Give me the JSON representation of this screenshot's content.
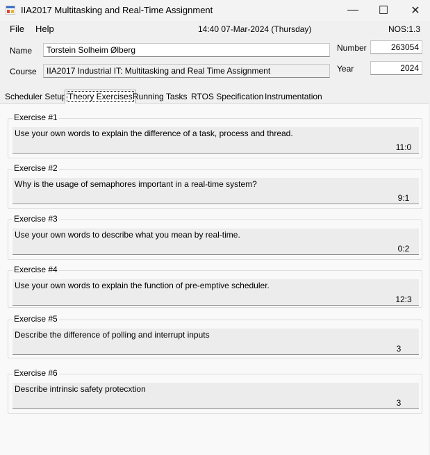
{
  "window": {
    "title": "IIA2017 Multitasking and Real-Time Assignment",
    "minimize_glyph": "—",
    "maximize_glyph": "☐",
    "close_glyph": "✕"
  },
  "menu": {
    "file": "File",
    "help": "Help",
    "datetime": "14:40 07-Mar-2024 (Thursday)",
    "nos": "NOS:1.3"
  },
  "form": {
    "name_label": "Name",
    "name_value": "Torstein Solheim Ølberg",
    "course_label": "Course",
    "course_value": "IIA2017 Industrial IT: Multitasking and Real Time Assignment",
    "number_label": "Number",
    "number_value": "263054",
    "year_label": "Year",
    "year_value": "2024"
  },
  "tabs": [
    {
      "label": "Scheduler Setup"
    },
    {
      "label": "Theory Exercises"
    },
    {
      "label": "Running Tasks"
    },
    {
      "label": "RTOS Specification"
    },
    {
      "label": "Instrumentation"
    }
  ],
  "exercises": [
    {
      "title": "Exercise #1",
      "question": "Use your own words to explain the difference of a task, process and thread.",
      "answer": "11:0"
    },
    {
      "title": "Exercise #2",
      "question": "Why is the usage of semaphores important in a real-time system?",
      "answer": "9:1"
    },
    {
      "title": "Exercise #3",
      "question": "Use your own words to describe what you mean by real-time.",
      "answer": "0:2"
    },
    {
      "title": "Exercise #4",
      "question": "Use your own words to explain the function of pre-emptive scheduler.",
      "answer": "12:3"
    },
    {
      "title": "Exercise #5",
      "question": "Describe the difference of polling and interrupt inputs",
      "answer": "3"
    },
    {
      "title": "Exercise #6",
      "question": "Describe intrinsic safety protecxtion",
      "answer": "3"
    }
  ]
}
